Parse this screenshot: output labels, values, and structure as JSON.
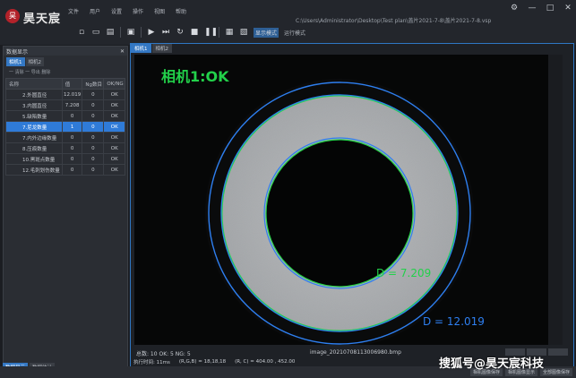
{
  "app": {
    "logo_char": "昊",
    "brand": "昊天宸",
    "path": "C:\\Users\\Administrator\\Desktop\\Test plan\\盖片2021-7-8\\盖片2021-7-8.vsp"
  },
  "menu": [
    "文件",
    "用户",
    "设置",
    "操作",
    "视图",
    "帮助"
  ],
  "window_controls": {
    "settings": "⚙",
    "minimize": "—",
    "maximize": "□",
    "close": "✕"
  },
  "toolbar": {
    "run_label": "显示模式",
    "mode_label": "运行模式"
  },
  "left_panel": {
    "title": "数据显示",
    "close": "✕",
    "tabs": [
      "相机1",
      "相机2"
    ],
    "subtitle": "一 清除  一 导出  删除",
    "columns": [
      "名称",
      "值",
      "Ng数目",
      "OK/NG"
    ],
    "rows": [
      {
        "name": "2.外圆直径",
        "value": "12.019",
        "ng": "0",
        "status": "OK"
      },
      {
        "name": "3.内圆直径",
        "value": "7.208",
        "ng": "0",
        "status": "OK"
      },
      {
        "name": "5.缺陷数量",
        "value": "0",
        "ng": "0",
        "status": "OK"
      },
      {
        "name": "7.尼龙数量",
        "value": "1",
        "ng": "0",
        "status": "OK"
      },
      {
        "name": "7.内外边缘数量",
        "value": "0",
        "ng": "0",
        "status": "OK"
      },
      {
        "name": "8.压痕数量",
        "value": "0",
        "ng": "0",
        "status": "OK"
      },
      {
        "name": "10.黑斑点数量",
        "value": "0",
        "ng": "0",
        "status": "OK"
      },
      {
        "name": "12.毛刺划伤数量",
        "value": "0",
        "ng": "0",
        "status": "OK"
      }
    ],
    "selected_index": 3,
    "bottom_tabs": [
      "数据显示",
      "数据统计"
    ]
  },
  "image_panel": {
    "tabs": [
      "相机1",
      "相机2"
    ],
    "camera_status": "相机1:OK",
    "inner_label": "D = 7.209",
    "outer_label": "D = 12.019",
    "counts": "总数: 10 OK: 5 NG: 5",
    "image_name": "image_20210708113006980.bmp"
  },
  "statusbar": {
    "time": "执行时间: 11ms",
    "rgb": "(R,G,B) = 18,18,18",
    "coords": "(R, C) = 404.00 , 452.00"
  },
  "bottom_buttons": [
    "相机图像保存",
    "相机图像显示",
    "全部图像保存"
  ],
  "watermark": "搜狐号@昊天宸科技",
  "colors": {
    "accent": "#3478c4",
    "ok_green": "#22d14a",
    "ring_blue": "#2e7ff0"
  }
}
